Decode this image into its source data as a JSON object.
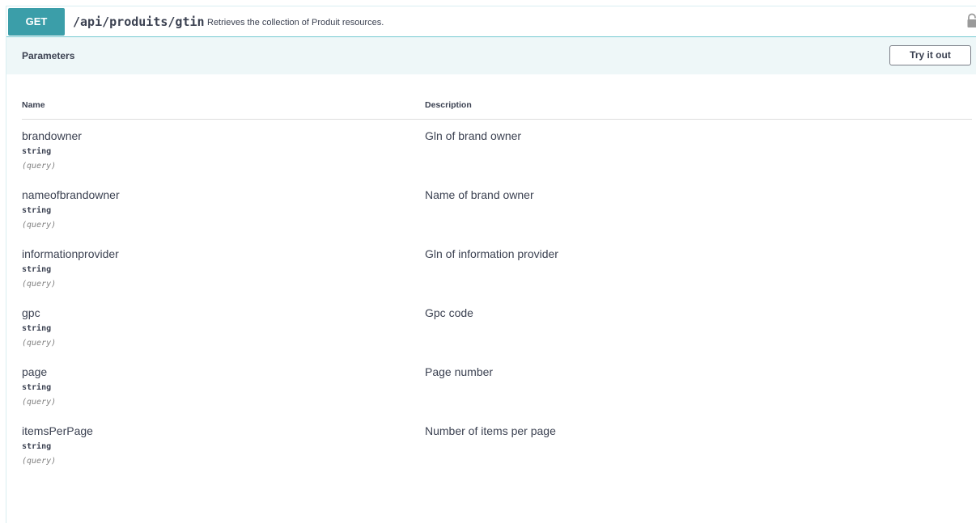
{
  "operation": {
    "method": "GET",
    "path": "/api/produits/gtin",
    "summary": "Retrieves the collection of Produit resources.",
    "lock_icon": "lock-icon"
  },
  "parameters_section": {
    "title": "Parameters",
    "try_button": "Try it out",
    "columns": {
      "name": "Name",
      "description": "Description"
    },
    "params": [
      {
        "name": "brandowner",
        "type": "string",
        "in": "(query)",
        "description": "Gln of brand owner"
      },
      {
        "name": "nameofbrandowner",
        "type": "string",
        "in": "(query)",
        "description": "Name of brand owner"
      },
      {
        "name": "informationprovider",
        "type": "string",
        "in": "(query)",
        "description": "Gln of information provider"
      },
      {
        "name": "gpc",
        "type": "string",
        "in": "(query)",
        "description": "Gpc code"
      },
      {
        "name": "page",
        "type": "string",
        "in": "(query)",
        "description": "Page number"
      },
      {
        "name": "itemsPerPage",
        "type": "string",
        "in": "(query)",
        "description": "Number of items per page"
      }
    ]
  },
  "colors": {
    "method_bg": "#3b9ea9",
    "header_bg": "#eef7f8",
    "border": "#76c9d1",
    "text": "#3b4151"
  }
}
